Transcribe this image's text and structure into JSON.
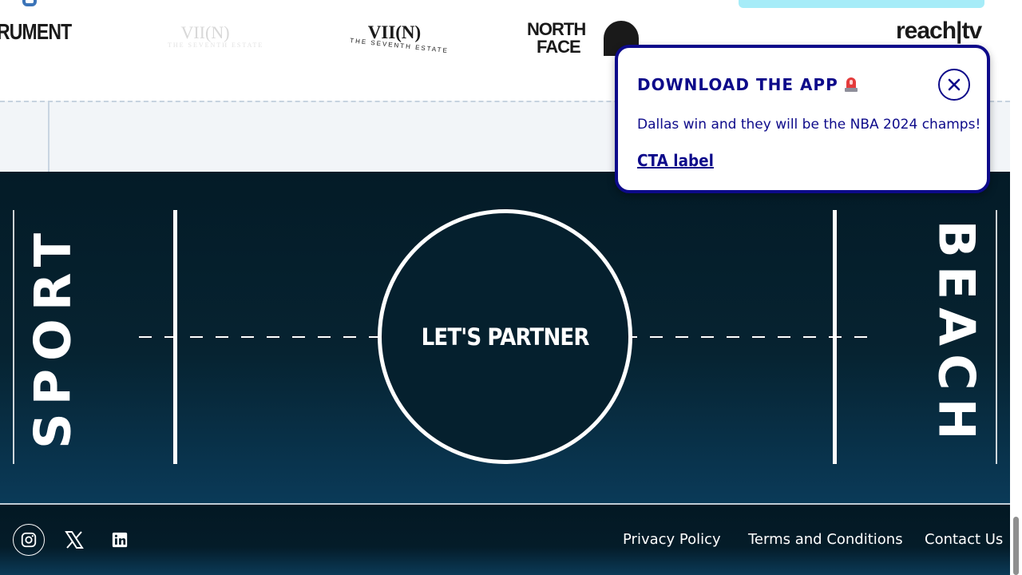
{
  "logos": {
    "instrument": "RUMENT",
    "faded_name": "VII(N)",
    "faded_sub": "THE SEVENTH ESTATE",
    "vii_name": "VII(N)",
    "vii_sub": "THE SEVENTH ESTATE",
    "north_face_line1": "NORTH",
    "north_face_line2": "FACE",
    "reach": "reach|tv"
  },
  "court": {
    "left_word": "SPORT",
    "right_word": "BEACH",
    "center_cta": "LET'S PARTNER"
  },
  "footer": {
    "social": [
      "instagram-icon",
      "x-icon",
      "linkedin-icon"
    ],
    "links": {
      "privacy": "Privacy Policy",
      "terms": "Terms and Conditions",
      "contact": "Contact Us"
    }
  },
  "popup": {
    "title": "DOWNLOAD THE APP",
    "title_icon": "siren-icon",
    "body": "Dallas win and they will be the NBA 2024 champs!",
    "cta_label": "CTA label",
    "close_icon": "close-icon"
  },
  "colors": {
    "popup_accent": "#0d0a8a",
    "court_dark": "#041b27",
    "court_light": "#0a3a58",
    "cyan_tab": "#a6ecf8",
    "text_on_dark": "#ffffff"
  }
}
